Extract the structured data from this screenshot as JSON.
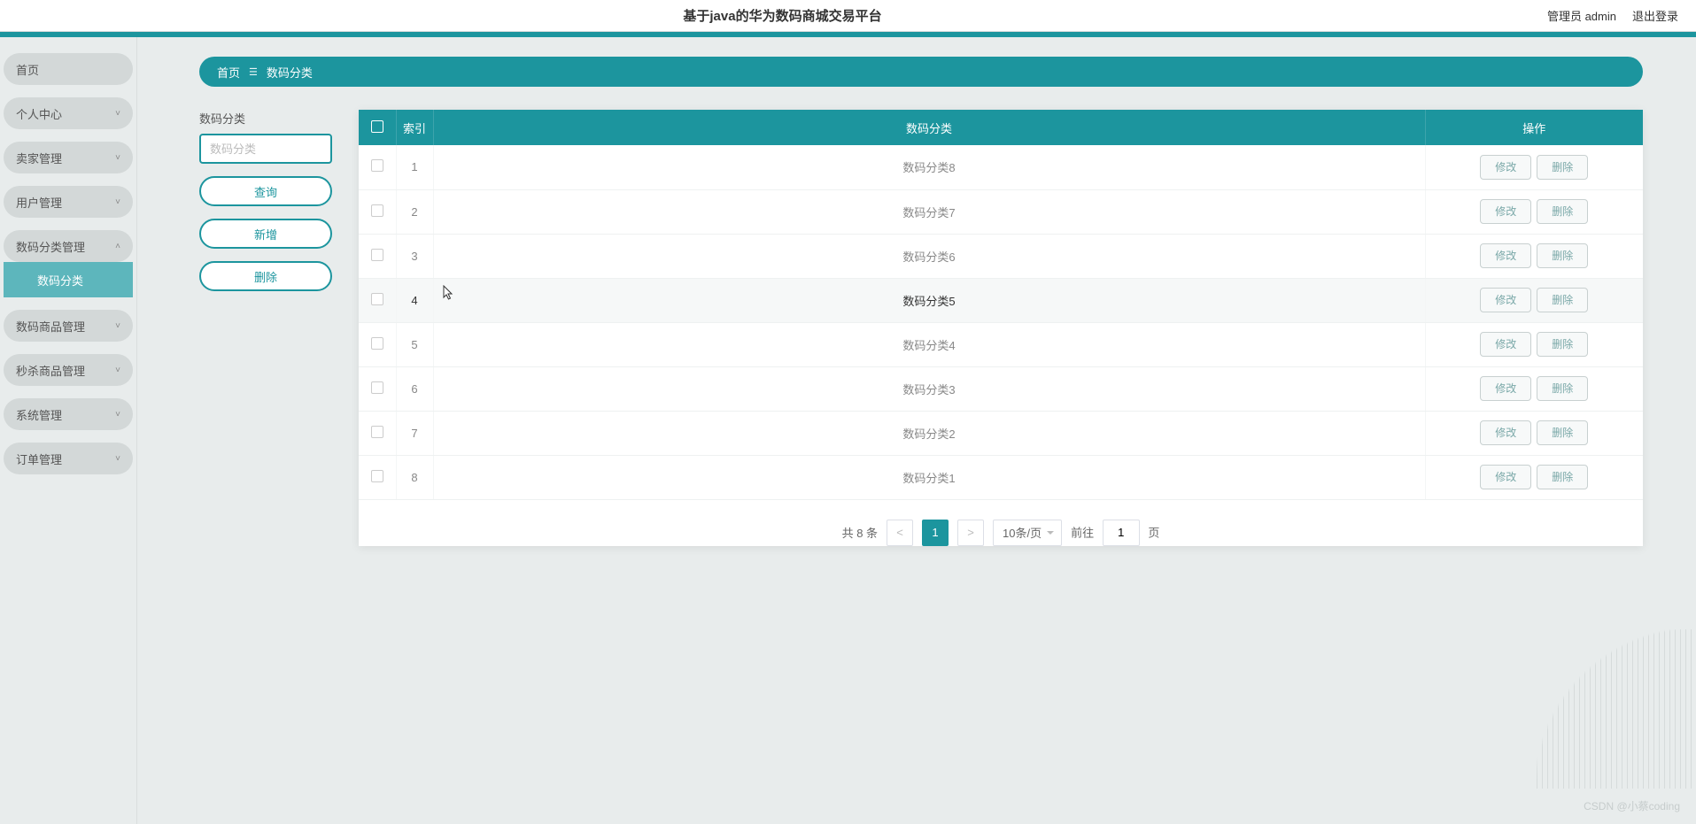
{
  "header": {
    "title": "基于java的华为数码商城交易平台",
    "admin_label": "管理员 admin",
    "logout": "退出登录"
  },
  "sidebar": {
    "items": [
      {
        "label": "首页",
        "expandable": false
      },
      {
        "label": "个人中心",
        "expandable": true
      },
      {
        "label": "卖家管理",
        "expandable": true
      },
      {
        "label": "用户管理",
        "expandable": true
      },
      {
        "label": "数码分类管理",
        "expandable": true,
        "expanded": true,
        "children": [
          {
            "label": "数码分类"
          }
        ]
      },
      {
        "label": "数码商品管理",
        "expandable": true
      },
      {
        "label": "秒杀商品管理",
        "expandable": true
      },
      {
        "label": "系统管理",
        "expandable": true
      },
      {
        "label": "订单管理",
        "expandable": true
      }
    ]
  },
  "breadcrumb": {
    "home": "首页",
    "current": "数码分类"
  },
  "filter": {
    "label": "数码分类",
    "placeholder": "数码分类",
    "query_btn": "查询",
    "add_btn": "新增",
    "delete_btn": "删除"
  },
  "table": {
    "headers": {
      "index": "索引",
      "category": "数码分类",
      "ops": "操作"
    },
    "edit_btn": "修改",
    "del_btn": "删除",
    "rows": [
      {
        "idx": "1",
        "name": "数码分类8"
      },
      {
        "idx": "2",
        "name": "数码分类7"
      },
      {
        "idx": "3",
        "name": "数码分类6"
      },
      {
        "idx": "4",
        "name": "数码分类5",
        "hover": true
      },
      {
        "idx": "5",
        "name": "数码分类4"
      },
      {
        "idx": "6",
        "name": "数码分类3"
      },
      {
        "idx": "7",
        "name": "数码分类2"
      },
      {
        "idx": "8",
        "name": "数码分类1"
      }
    ]
  },
  "pagination": {
    "total_label": "共 8 条",
    "page_size": "10条/页",
    "current": "1",
    "jump_prefix": "前往",
    "jump_value": "1",
    "jump_suffix": "页"
  },
  "watermark": "CSDN @小蔡coding"
}
